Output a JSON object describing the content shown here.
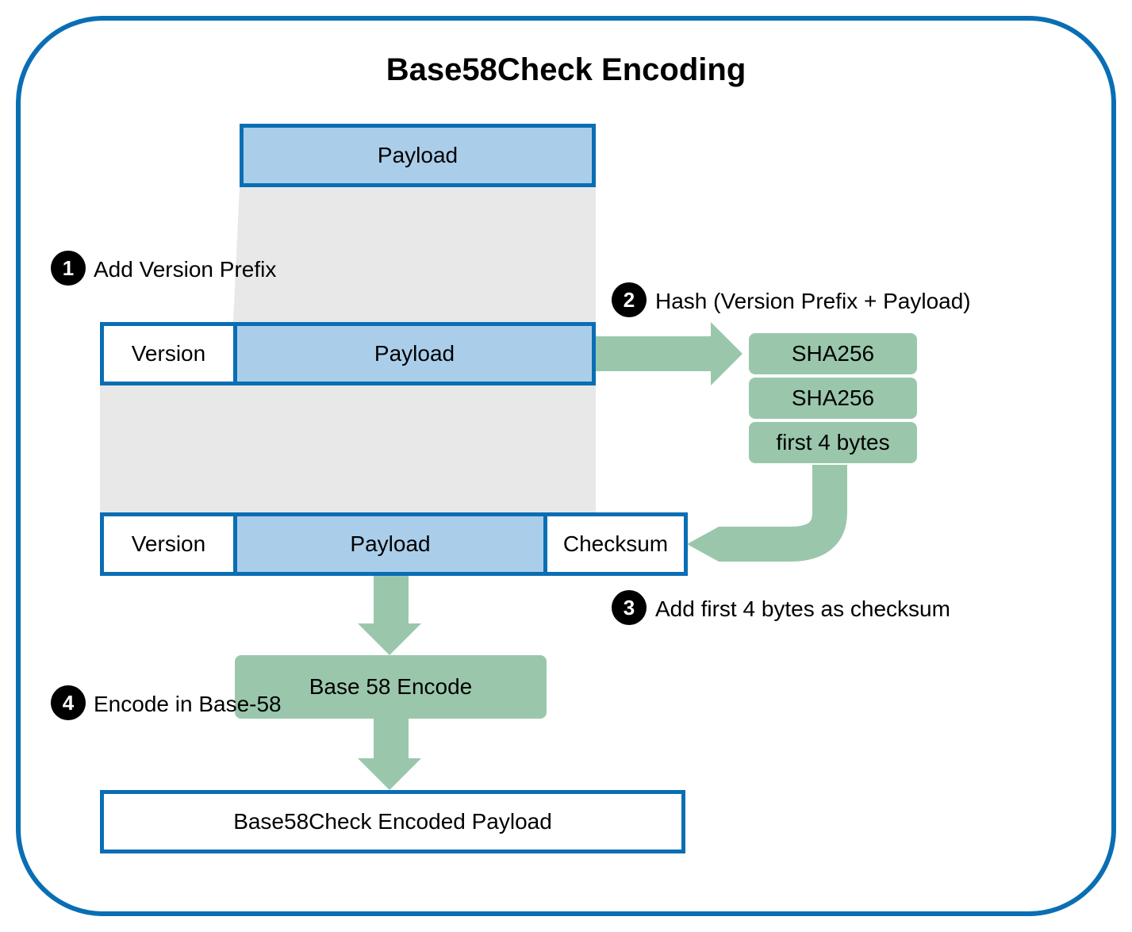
{
  "title": "Base58Check Encoding",
  "row0": {
    "payload": "Payload"
  },
  "row1": {
    "version": "Version",
    "payload": "Payload"
  },
  "row2": {
    "version": "Version",
    "payload": "Payload",
    "checksum": "Checksum"
  },
  "hash": {
    "line1": "SHA256",
    "line2": "SHA256",
    "line3": "first 4 bytes"
  },
  "encode": "Base 58 Encode",
  "result": "Base58Check Encoded Payload",
  "steps": {
    "s1": {
      "num": "1",
      "label": "Add Version Prefix"
    },
    "s2": {
      "num": "2",
      "label": "Hash (Version Prefix + Payload)"
    },
    "s3": {
      "num": "3",
      "label": "Add first 4 bytes as checksum"
    },
    "s4": {
      "num": "4",
      "label": "Encode in Base-58"
    }
  }
}
